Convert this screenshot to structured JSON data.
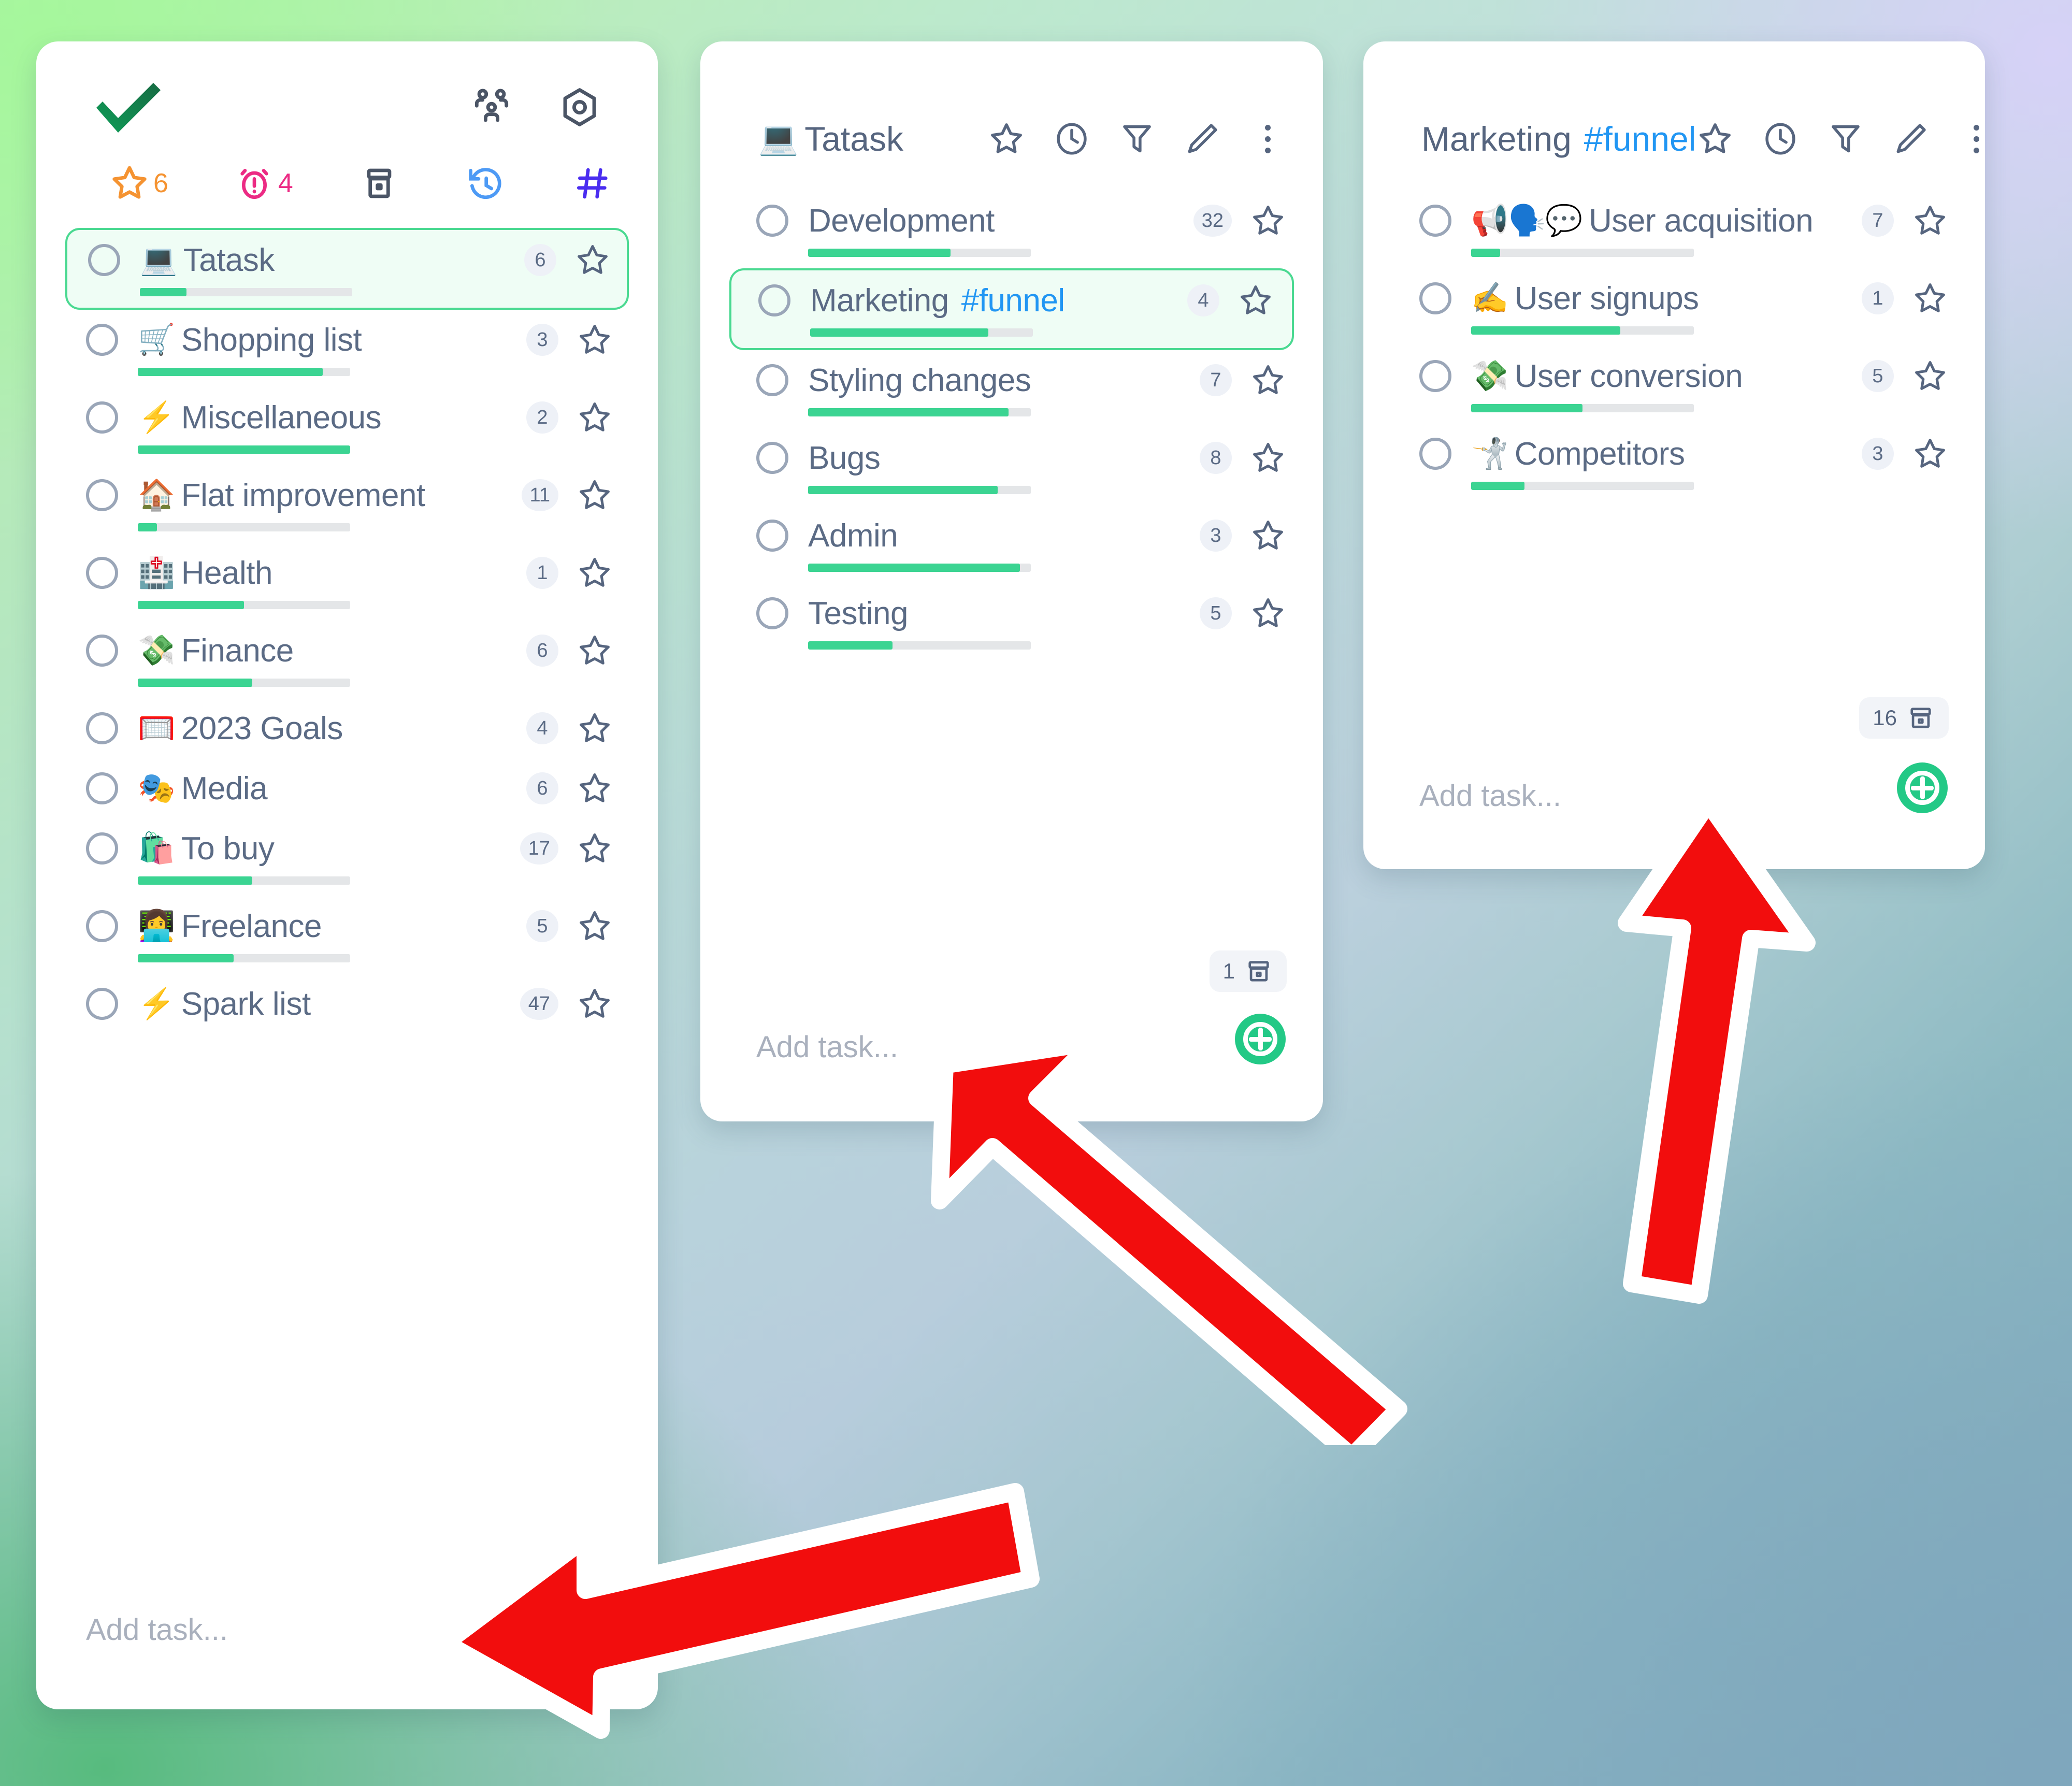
{
  "app": {
    "logo": "green-checkmark",
    "accent_green": "#23c986",
    "accent_blue": "#2196f3",
    "text_color": "#56657f"
  },
  "sidebar": {
    "top_icons": [
      {
        "name": "people-icon",
        "label": "Collaborators"
      },
      {
        "name": "settings-hex-icon",
        "label": "Settings"
      }
    ],
    "filters": [
      {
        "name": "star-filter",
        "icon": "star-icon",
        "count": "6",
        "color": "#f59331"
      },
      {
        "name": "alarm-filter",
        "icon": "alarm-icon",
        "count": "4",
        "color": "#ec2b84"
      },
      {
        "name": "archive-filter",
        "icon": "archive-icon",
        "count": "",
        "color": "#4b5566"
      },
      {
        "name": "history-filter",
        "icon": "history-icon",
        "count": "",
        "color": "#4d9af5"
      },
      {
        "name": "tags-filter",
        "icon": "hash-icon",
        "count": "",
        "color": "#4a2df0"
      },
      {
        "name": "search-filter",
        "icon": "search-icon",
        "count": "",
        "color": "#0d9b74"
      }
    ],
    "items": [
      {
        "emoji": "💻",
        "label": "Tatask",
        "count": "6",
        "progress": 22,
        "selected": true,
        "has_bar": true
      },
      {
        "emoji": "🛒",
        "label": "Shopping list",
        "count": "3",
        "progress": 87,
        "selected": false,
        "has_bar": true
      },
      {
        "emoji": "⚡",
        "label": "Miscellaneous",
        "count": "2",
        "progress": 100,
        "selected": false,
        "has_bar": true
      },
      {
        "emoji": "🏠",
        "label": "Flat improvement",
        "count": "11",
        "progress": 9,
        "selected": false,
        "has_bar": true
      },
      {
        "emoji": "🏥",
        "label": "Health",
        "count": "1",
        "progress": 50,
        "selected": false,
        "has_bar": true
      },
      {
        "emoji": "💸",
        "label": "Finance",
        "count": "6",
        "progress": 54,
        "selected": false,
        "has_bar": true
      },
      {
        "emoji": "🥅",
        "label": "2023 Goals",
        "count": "4",
        "progress": 0,
        "selected": false,
        "has_bar": false
      },
      {
        "emoji": "🎭",
        "label": "Media",
        "count": "6",
        "progress": 0,
        "selected": false,
        "has_bar": false
      },
      {
        "emoji": "🛍️",
        "label": "To buy",
        "count": "17",
        "progress": 54,
        "selected": false,
        "has_bar": true
      },
      {
        "emoji": "👩‍💻",
        "label": "Freelance",
        "count": "5",
        "progress": 45,
        "selected": false,
        "has_bar": true
      },
      {
        "emoji": "⚡",
        "label": "Spark list",
        "count": "47",
        "progress": 0,
        "selected": false,
        "has_bar": false
      }
    ],
    "add_task": "Add task..."
  },
  "tatask_panel": {
    "title": "Tatask",
    "emoji": "💻",
    "header_icons": [
      {
        "name": "star-icon"
      },
      {
        "name": "clock-icon"
      },
      {
        "name": "filter-icon"
      },
      {
        "name": "pencil-icon"
      },
      {
        "name": "kebab-menu-icon"
      }
    ],
    "items": [
      {
        "label": "Development",
        "tag": "",
        "count": "32",
        "progress": 64,
        "selected": false
      },
      {
        "label": "Marketing",
        "tag": "#funnel",
        "count": "4",
        "progress": 80,
        "selected": true
      },
      {
        "label": "Styling changes",
        "tag": "",
        "count": "7",
        "progress": 90,
        "selected": false
      },
      {
        "label": "Bugs",
        "tag": "",
        "count": "8",
        "progress": 85,
        "selected": false
      },
      {
        "label": "Admin",
        "tag": "",
        "count": "3",
        "progress": 95,
        "selected": false
      },
      {
        "label": "Testing",
        "tag": "",
        "count": "5",
        "progress": 38,
        "selected": false
      }
    ],
    "archive_count": "1",
    "add_task": "Add task..."
  },
  "funnel_panel": {
    "title": "Marketing",
    "tag": "#funnel",
    "header_icons": [
      {
        "name": "star-icon"
      },
      {
        "name": "clock-icon"
      },
      {
        "name": "filter-icon"
      },
      {
        "name": "pencil-icon"
      },
      {
        "name": "kebab-menu-icon"
      }
    ],
    "items": [
      {
        "emoji": "📢🗣️💬",
        "label": "User acquisition",
        "count": "7",
        "progress": 13,
        "selected": false
      },
      {
        "emoji": "✍️",
        "label": "User signups",
        "count": "1",
        "progress": 67,
        "selected": false
      },
      {
        "emoji": "💸",
        "label": "User conversion",
        "count": "5",
        "progress": 50,
        "selected": false
      },
      {
        "emoji": "🤺",
        "label": "Competitors",
        "count": "3",
        "progress": 24,
        "selected": false
      }
    ],
    "archive_count": "16",
    "add_task": "Add task..."
  },
  "annotations": {
    "arrows": [
      {
        "name": "arrow-to-tatask-add-task",
        "color": "#f20d0d",
        "direction": "up-left"
      },
      {
        "name": "arrow-to-funnel-add-task",
        "color": "#f20d0d",
        "direction": "up"
      },
      {
        "name": "arrow-to-sidebar-add-task",
        "color": "#f20d0d",
        "direction": "left"
      }
    ]
  }
}
